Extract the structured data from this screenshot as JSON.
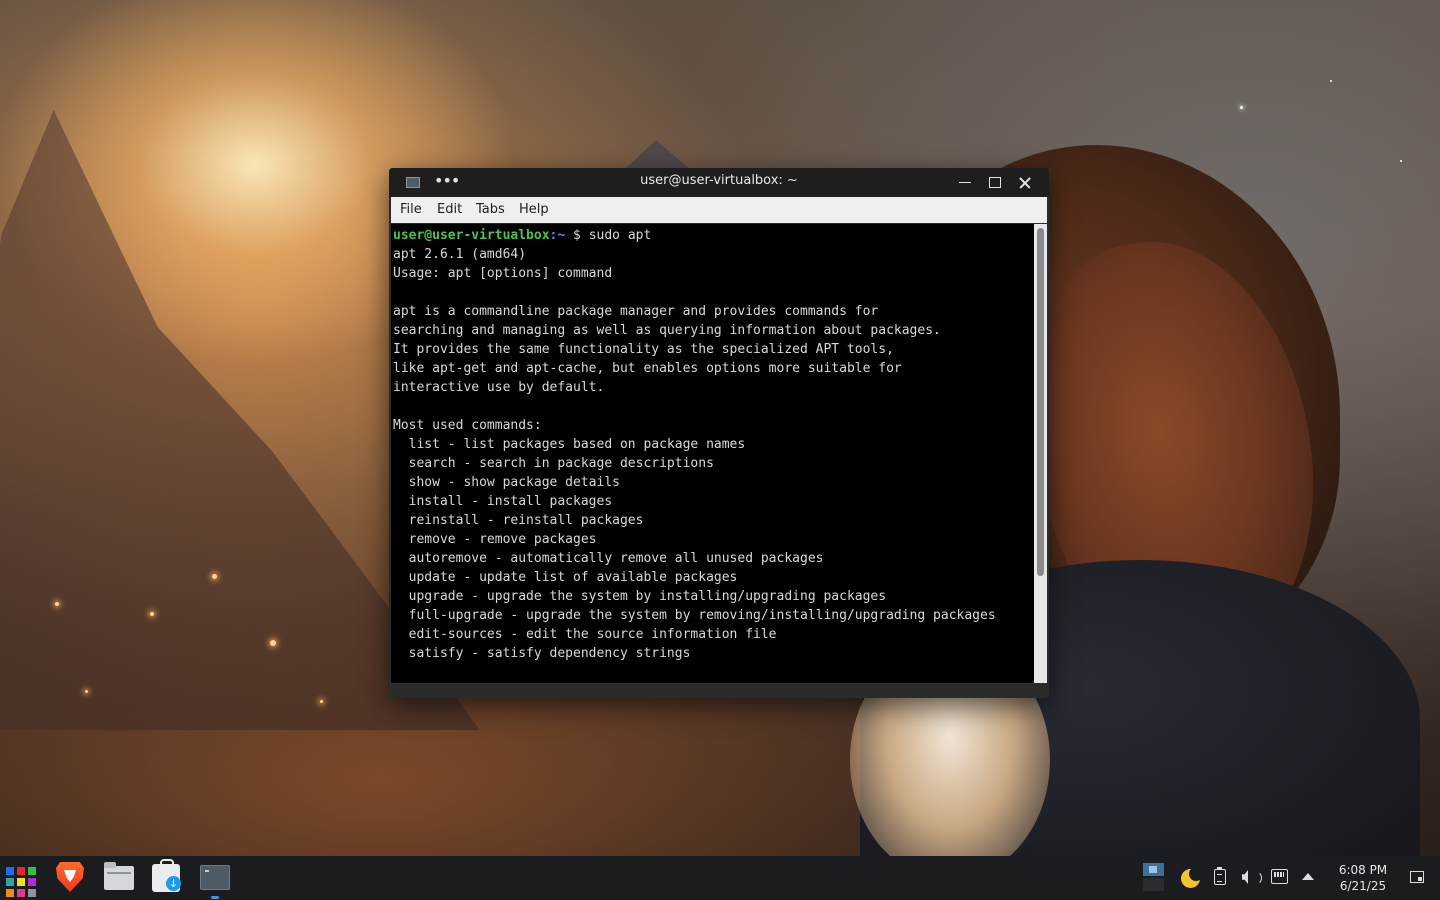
{
  "window": {
    "title": "user@user-virtualbox: ~",
    "menu": [
      "File",
      "Edit",
      "Tabs",
      "Help"
    ]
  },
  "terminal": {
    "prompt_user": "user@user-virtualbox",
    "prompt_path": ":~",
    "prompt_symbol": "$",
    "command": "sudo apt",
    "output": "apt 2.6.1 (amd64)\nUsage: apt [options] command\n\napt is a commandline package manager and provides commands for\nsearching and managing as well as querying information about packages.\nIt provides the same functionality as the specialized APT tools,\nlike apt-get and apt-cache, but enables options more suitable for\ninteractive use by default.\n\nMost used commands:\n  list - list packages based on package names\n  search - search in package descriptions\n  show - show package details\n  install - install packages\n  reinstall - reinstall packages\n  remove - remove packages\n  autoremove - automatically remove all unused packages\n  update - update list of available packages\n  upgrade - upgrade the system by installing/upgrading packages\n  full-upgrade - upgrade the system by removing/installing/upgrading packages\n  edit-sources - edit the source information file\n  satisfy - satisfy dependency strings"
  },
  "taskbar": {
    "apps": [
      {
        "icon": "app-launcher-icon"
      },
      {
        "icon": "brave-browser-icon"
      },
      {
        "icon": "file-manager-icon"
      },
      {
        "icon": "software-store-icon"
      },
      {
        "icon": "terminal-icon",
        "active": true
      }
    ],
    "tray": [
      "pager-icon",
      "night-light-icon",
      "clipboard-icon",
      "volume-icon",
      "network-icon",
      "tray-expand-icon"
    ],
    "clock_time": "6:08 PM",
    "clock_date": "6/21/25"
  },
  "colors": {
    "prompt_user": "#4ec24e",
    "prompt_path": "#5a8adf",
    "terminal_bg": "#000000",
    "taskbar_bg": "#1b1c1f",
    "accent": "#2e9bea"
  }
}
